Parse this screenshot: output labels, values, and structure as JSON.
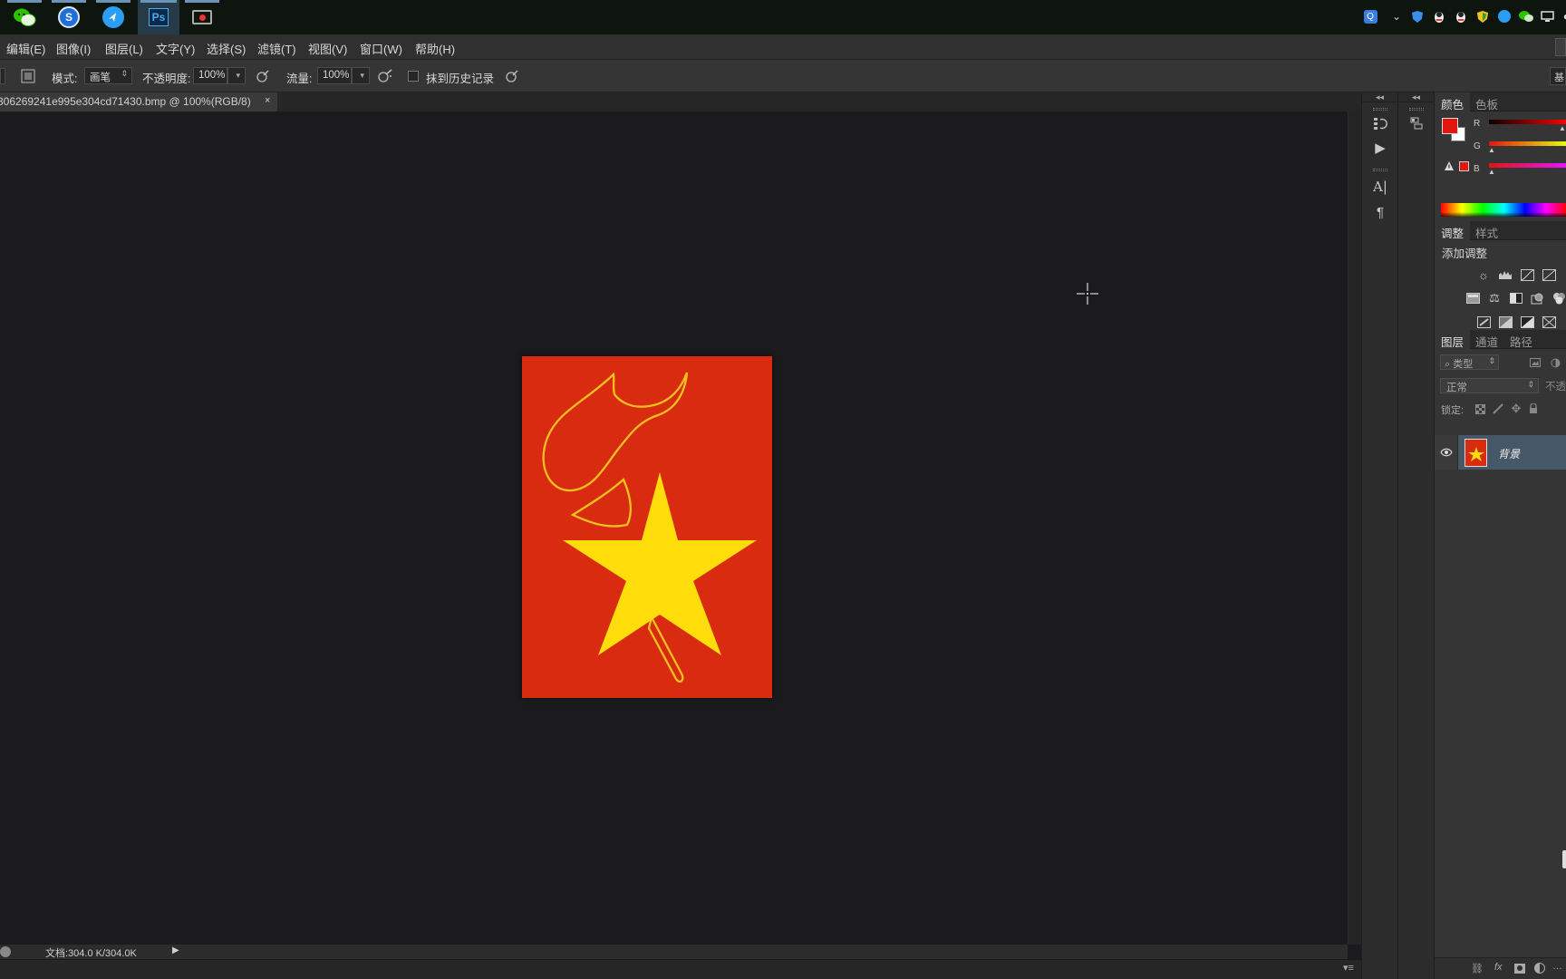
{
  "taskbar": {
    "apps": [
      {
        "name": "wechat-icon",
        "glyph": "",
        "color": "#2dc100",
        "active": false
      },
      {
        "name": "sogou-icon",
        "glyph": "S",
        "color": "#1e6fd9",
        "active": false
      },
      {
        "name": "bird-app-icon",
        "glyph": "",
        "color": "#2a9df4",
        "active": false
      },
      {
        "name": "photoshop-icon",
        "glyph": "Ps",
        "color": "#0b2a4a",
        "active": true
      },
      {
        "name": "screen-recorder-icon",
        "glyph": "",
        "color": "#333333",
        "active": false
      }
    ]
  },
  "menu": [
    {
      "label": "编辑(E)"
    },
    {
      "label": "图像(I)"
    },
    {
      "label": "图层(L)"
    },
    {
      "label": "文字(Y)"
    },
    {
      "label": "选择(S)"
    },
    {
      "label": "滤镜(T)"
    },
    {
      "label": "视图(V)"
    },
    {
      "label": "窗口(W)"
    },
    {
      "label": "帮助(H)"
    }
  ],
  "options": {
    "mode_label": "模式:",
    "mode_value": "画笔",
    "opacity_label": "不透明度:",
    "opacity_value": "100%",
    "flow_label": "流量:",
    "flow_value": "100%",
    "erase_history_label": "抹到历史记录",
    "workspace_label": "基"
  },
  "document": {
    "tab_title": "306269241e995e304cd71430.bmp @ 100%(RGB/8)",
    "close_glyph": "×",
    "status": "文档:304.0 K/304.0K"
  },
  "panels": {
    "color_tabs": [
      "颜色",
      "色板"
    ],
    "channels": [
      "R",
      "G",
      "B"
    ],
    "foreground_color": "#e3150f",
    "background_color": "#ffffff",
    "adjust_tabs": [
      "调整",
      "样式"
    ],
    "adjust_title": "添加调整",
    "layer_tabs": [
      "图层",
      "通道",
      "路径"
    ],
    "layer_filter": "类型",
    "blend_mode": "正常",
    "opacity_short": "不透",
    "lock_label": "锁定:",
    "layer_name": "背景"
  },
  "colors": {
    "image_red": "#d92b10",
    "star_yellow": "#ffdd0a",
    "outline_yellow": "#f5c21c"
  }
}
